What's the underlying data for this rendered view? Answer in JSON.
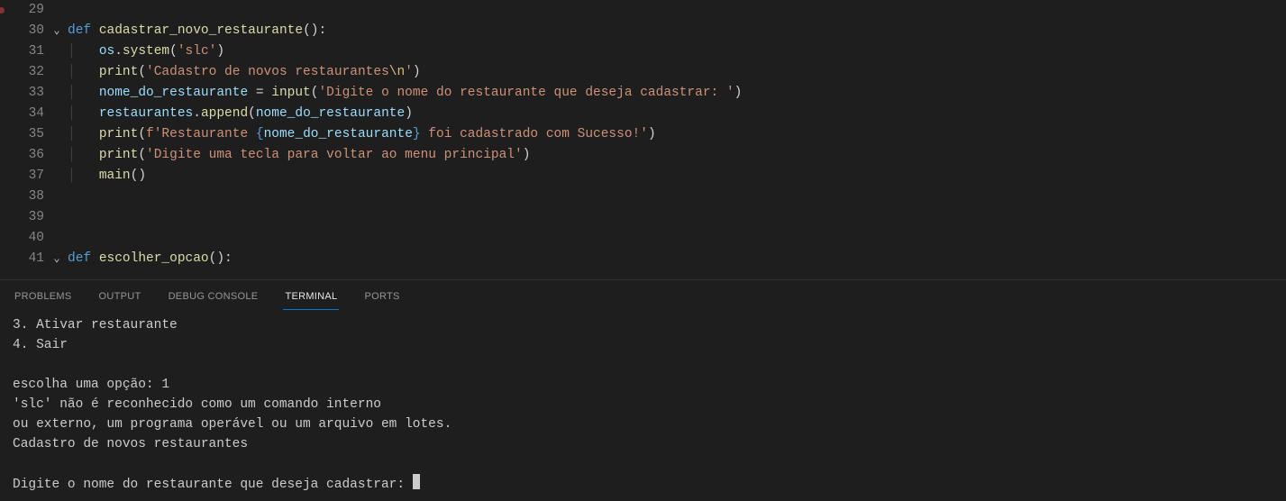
{
  "editor": {
    "lines": [
      {
        "num": 29,
        "breakpoint": true,
        "fold": false,
        "tokens": []
      },
      {
        "num": 30,
        "breakpoint": false,
        "fold": true,
        "tokens": [
          {
            "t": "kw",
            "v": "def "
          },
          {
            "t": "fn",
            "v": "cadastrar_novo_restaurante"
          },
          {
            "t": "punc",
            "v": "():"
          }
        ]
      },
      {
        "num": 31,
        "breakpoint": false,
        "fold": false,
        "indent": true,
        "tokens": [
          {
            "t": "var",
            "v": "os"
          },
          {
            "t": "punc",
            "v": "."
          },
          {
            "t": "fn",
            "v": "system"
          },
          {
            "t": "punc",
            "v": "("
          },
          {
            "t": "str",
            "v": "'slc'"
          },
          {
            "t": "punc",
            "v": ")"
          }
        ]
      },
      {
        "num": 32,
        "breakpoint": false,
        "fold": false,
        "indent": true,
        "tokens": [
          {
            "t": "fn",
            "v": "print"
          },
          {
            "t": "punc",
            "v": "("
          },
          {
            "t": "str",
            "v": "'Cadastro de novos restaurantes"
          },
          {
            "t": "esc",
            "v": "\\n"
          },
          {
            "t": "str",
            "v": "'"
          },
          {
            "t": "punc",
            "v": ")"
          }
        ]
      },
      {
        "num": 33,
        "breakpoint": false,
        "fold": false,
        "indent": true,
        "tokens": [
          {
            "t": "var",
            "v": "nome_do_restaurante"
          },
          {
            "t": "op",
            "v": " = "
          },
          {
            "t": "fn",
            "v": "input"
          },
          {
            "t": "punc",
            "v": "("
          },
          {
            "t": "str",
            "v": "'Digite o nome do restaurante que deseja cadastrar: '"
          },
          {
            "t": "punc",
            "v": ")"
          }
        ]
      },
      {
        "num": 34,
        "breakpoint": false,
        "fold": false,
        "indent": true,
        "tokens": [
          {
            "t": "var",
            "v": "restaurantes"
          },
          {
            "t": "punc",
            "v": "."
          },
          {
            "t": "fn",
            "v": "append"
          },
          {
            "t": "punc",
            "v": "("
          },
          {
            "t": "var",
            "v": "nome_do_restaurante"
          },
          {
            "t": "punc",
            "v": ")"
          }
        ]
      },
      {
        "num": 35,
        "breakpoint": false,
        "fold": false,
        "indent": true,
        "tokens": [
          {
            "t": "fn",
            "v": "print"
          },
          {
            "t": "punc",
            "v": "("
          },
          {
            "t": "str",
            "v": "f'Restaurante "
          },
          {
            "t": "tmpl",
            "v": "{"
          },
          {
            "t": "tmplv",
            "v": "nome_do_restaurante"
          },
          {
            "t": "tmpl",
            "v": "}"
          },
          {
            "t": "str",
            "v": " foi cadastrado com Sucesso!'"
          },
          {
            "t": "punc",
            "v": ")"
          }
        ]
      },
      {
        "num": 36,
        "breakpoint": false,
        "fold": false,
        "indent": true,
        "tokens": [
          {
            "t": "fn",
            "v": "print"
          },
          {
            "t": "punc",
            "v": "("
          },
          {
            "t": "str",
            "v": "'Digite uma tecla para voltar ao menu principal'"
          },
          {
            "t": "punc",
            "v": ")"
          }
        ]
      },
      {
        "num": 37,
        "breakpoint": false,
        "fold": false,
        "indent": true,
        "tokens": [
          {
            "t": "fn",
            "v": "main"
          },
          {
            "t": "punc",
            "v": "()"
          }
        ]
      },
      {
        "num": 38,
        "breakpoint": false,
        "fold": false,
        "tokens": []
      },
      {
        "num": 39,
        "breakpoint": false,
        "fold": false,
        "tokens": []
      },
      {
        "num": 40,
        "breakpoint": false,
        "fold": false,
        "tokens": []
      },
      {
        "num": 41,
        "breakpoint": false,
        "fold": true,
        "tokens": [
          {
            "t": "kw",
            "v": "def "
          },
          {
            "t": "fn",
            "v": "escolher_opcao"
          },
          {
            "t": "punc",
            "v": "():"
          }
        ]
      }
    ]
  },
  "panel": {
    "tabs": {
      "problems": "PROBLEMS",
      "output": "OUTPUT",
      "debug": "DEBUG CONSOLE",
      "terminal": "TERMINAL",
      "ports": "PORTS"
    },
    "active_tab": "terminal"
  },
  "terminal": {
    "lines": [
      "3. Ativar restaurante",
      "4. Sair",
      "",
      "escolha uma opção: 1",
      "'slc' não é reconhecido como um comando interno",
      "ou externo, um programa operável ou um arquivo em lotes.",
      "Cadastro de novos restaurantes",
      "",
      "Digite o nome do restaurante que deseja cadastrar: "
    ],
    "cursor_on_last": true
  }
}
